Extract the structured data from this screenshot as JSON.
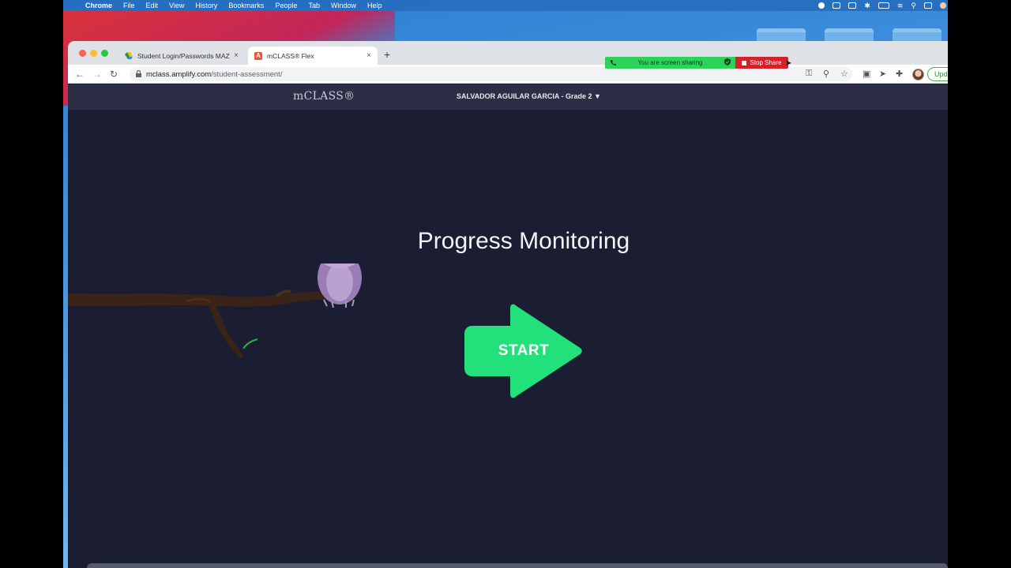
{
  "menubar": {
    "app": "Chrome",
    "items": [
      "File",
      "Edit",
      "View",
      "History",
      "Bookmarks",
      "People",
      "Tab",
      "Window",
      "Help"
    ]
  },
  "tabs": [
    {
      "label": "Student Login/Passwords MAZ",
      "active": false,
      "icon": "google-drive-icon"
    },
    {
      "label": "mCLASS® Flex",
      "active": true,
      "icon": "amplify-icon"
    }
  ],
  "address_bar": {
    "domain": "mclass.amplify.com",
    "path": "/student-assessment/"
  },
  "update_button": {
    "label": "Upd"
  },
  "screen_share": {
    "status": "You are screen sharing",
    "stop_label": "Stop Share"
  },
  "app": {
    "logo": "mCLASS®",
    "student": "SALVADOR AGUILAR GARCIA - Grade 2 ▼",
    "title": "Progress Monitoring",
    "start_label": "START"
  },
  "colors": {
    "background": "#1b1e33",
    "header": "#2b2e45",
    "start_green": "#22e07a",
    "share_green": "#2bd35a",
    "share_red": "#d6202a"
  }
}
